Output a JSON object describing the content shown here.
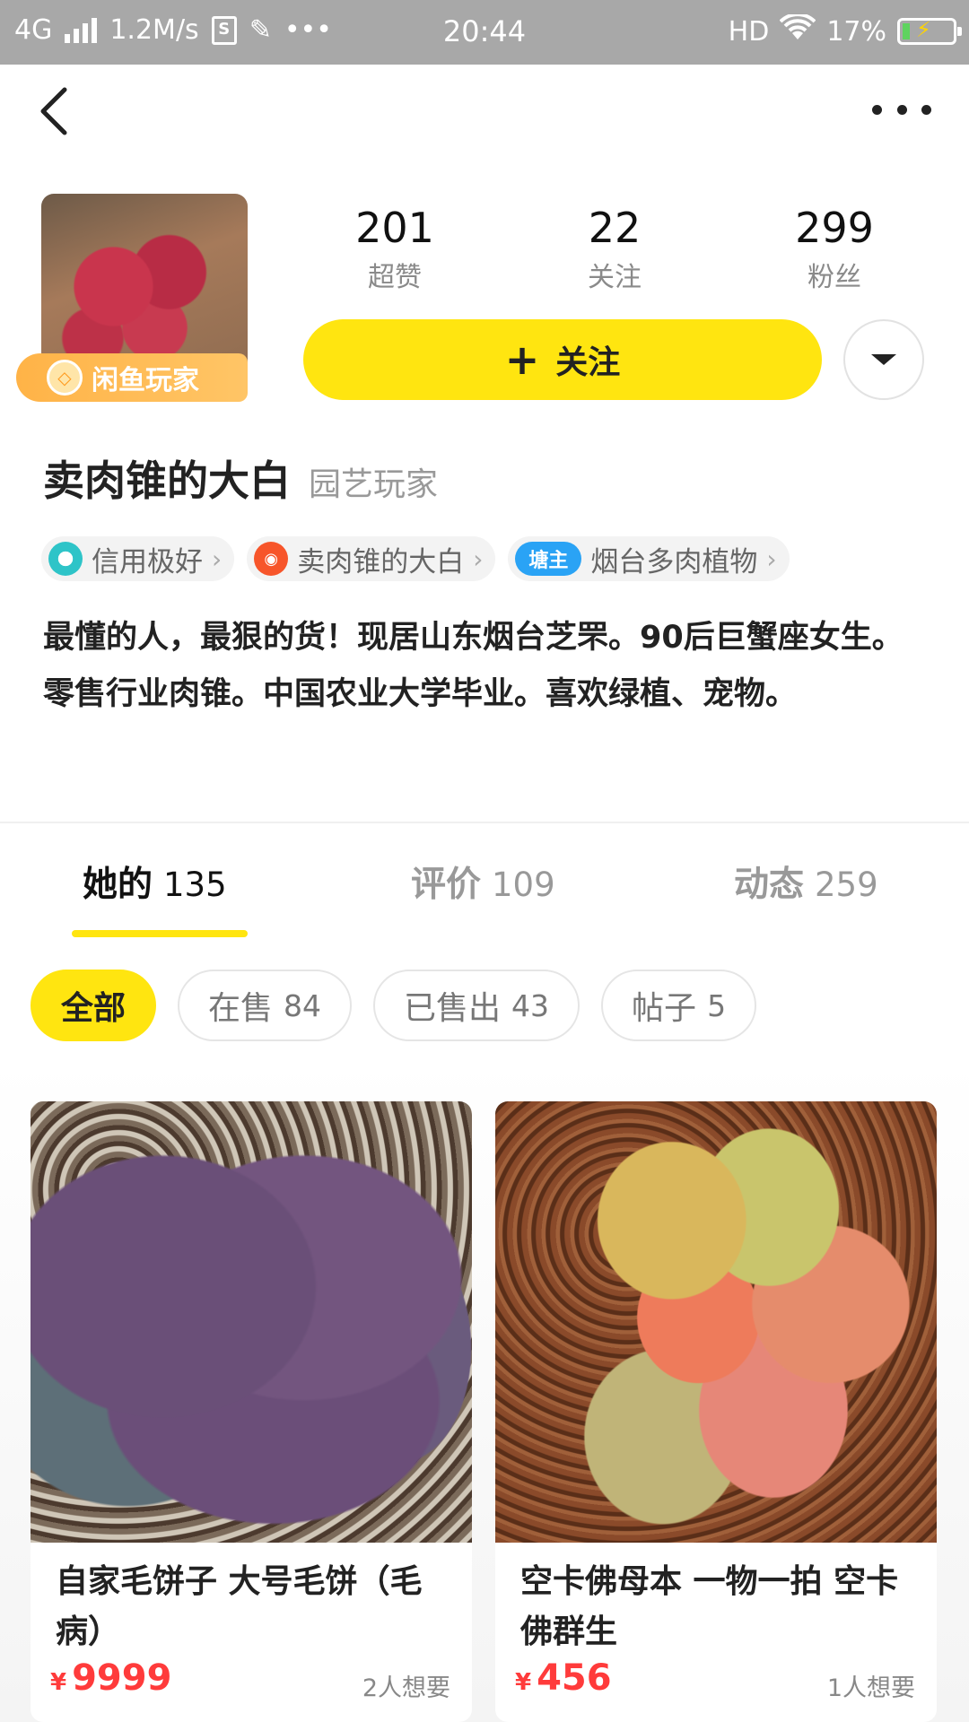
{
  "status_bar": {
    "network": "4G",
    "speed": "1.2M/s",
    "time": "20:44",
    "hd": "HD",
    "battery": "17%"
  },
  "profile": {
    "badge_label": "闲鱼玩家",
    "stats": [
      {
        "value": "201",
        "label": "超赞"
      },
      {
        "value": "22",
        "label": "关注"
      },
      {
        "value": "299",
        "label": "粉丝"
      }
    ],
    "follow_label": "关注",
    "username": "卖肉锥的大白",
    "user_type": "园艺玩家",
    "tags": [
      {
        "icon": "credit-icon",
        "label": "信用极好"
      },
      {
        "icon": "weibo-icon",
        "label": "卖肉锥的大白"
      },
      {
        "icon_text": "塘主",
        "label": "烟台多肉植物"
      }
    ],
    "bio": "最懂的人，最狠的货！现居山东烟台芝罘。90后巨蟹座女生。零售行业肉锥。中国农业大学毕业。喜欢绿植、宠物。"
  },
  "tabs": [
    {
      "label": "她的",
      "count": "135"
    },
    {
      "label": "评价",
      "count": "109"
    },
    {
      "label": "动态",
      "count": "259"
    }
  ],
  "filters": [
    {
      "label": "全部",
      "count": ""
    },
    {
      "label": "在售",
      "count": "84"
    },
    {
      "label": "已售出",
      "count": "43"
    },
    {
      "label": "帖子",
      "count": "5"
    }
  ],
  "products": [
    {
      "title": "自家毛饼子 大号毛饼（毛病）",
      "currency": "¥",
      "price": "9999",
      "want": "2人想要"
    },
    {
      "title": "空卡佛母本 一物一拍 空卡佛群生",
      "currency": "¥",
      "price": "456",
      "want": "1人想要"
    }
  ],
  "colors": {
    "accent": "#ffe510",
    "price": "#ff3b3b",
    "status_bar": "#a8a8a8"
  }
}
